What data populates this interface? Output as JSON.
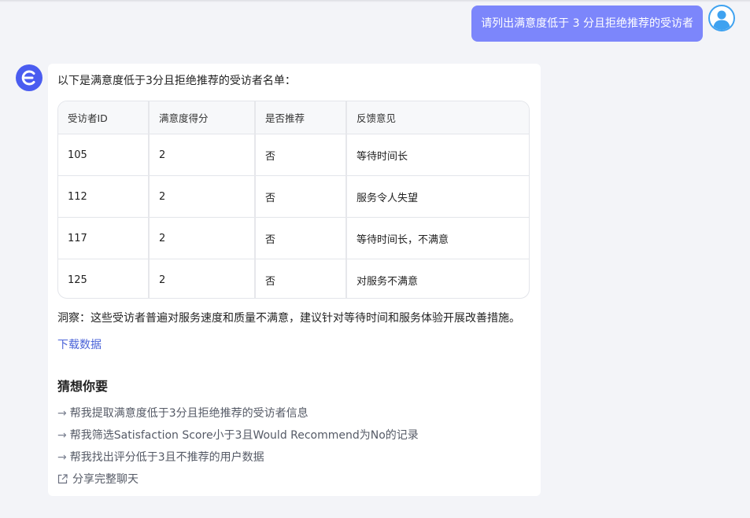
{
  "colors": {
    "user_bubble": "#7c86fb",
    "bot_avatar": "#4a5cf0",
    "link": "#4a63d8",
    "page_bg": "#f3f4f8"
  },
  "user_message": {
    "text": "请列出满意度低于 3 分且拒绝推荐的受访者",
    "avatar_icon": "user-avatar-icon"
  },
  "bot": {
    "avatar_icon": "assistant-logo-icon",
    "intro": "以下是满意度低于3分且拒绝推荐的受访者名单：",
    "table": {
      "headers": [
        "受访者ID",
        "满意度得分",
        "是否推荐",
        "反馈意见"
      ],
      "rows": [
        [
          "105",
          "2",
          "否",
          "等待时间长"
        ],
        [
          "112",
          "2",
          "否",
          "服务令人失望"
        ],
        [
          "117",
          "2",
          "否",
          "等待时间长，不满意"
        ],
        [
          "125",
          "2",
          "否",
          "对服务不满意"
        ]
      ]
    },
    "insight": "洞察：这些受访者普遍对服务速度和质量不满意，建议针对等待时间和服务体验开展改善措施。",
    "download_label": "下载数据",
    "guess_title": "猜想你要",
    "suggestions": [
      "帮我提取满意度低于3分且拒绝推荐的受访者信息",
      "帮我筛选Satisfaction Score小于3且Would Recommend为No的记录",
      "帮我找出评分低于3且不推荐的用户数据"
    ],
    "arrow_glyph": "→",
    "share_label": "分享完整聊天",
    "share_icon": "external-link-icon"
  }
}
